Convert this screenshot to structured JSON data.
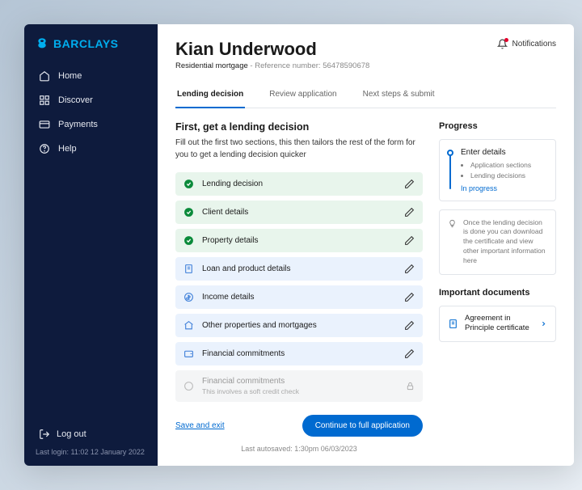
{
  "brand": "BARCLAYS",
  "nav": {
    "home": "Home",
    "discover": "Discover",
    "payments": "Payments",
    "help": "Help"
  },
  "logout": "Log out",
  "last_login": "Last login: 11:02 12 January 2022",
  "applicant_name": "Kian Underwood",
  "product": "Residential mortgage",
  "ref_prefix": " - Reference number: ",
  "ref_number": "56478590678",
  "notifications": "Notifications",
  "tabs": {
    "lending": "Lending decision",
    "review": "Review application",
    "next": "Next steps & submit"
  },
  "section": {
    "title": "First, get a lending decision",
    "desc": "Fill out the first two sections, this then tailors the rest of the form for you to get a lending decision quicker"
  },
  "items": {
    "lending": "Lending decision",
    "client": "Client details",
    "property": "Property details",
    "loan": "Loan and product details",
    "income": "Income details",
    "other": "Other properties and mortgages",
    "fin": "Financial commitments",
    "locked_title": "Financial commitments",
    "locked_sub": "This involves a soft credit check"
  },
  "save_exit": "Save and exit",
  "cta": "Continue to full application",
  "autosave": "Last autosaved:  1:30pm 06/03/2023",
  "progress": {
    "title": "Progress",
    "step": "Enter details",
    "b1": "Application sections",
    "b2": "Lending decisions",
    "status": "In progress",
    "hint": "Once the lending decision is done you can download the certificate and view other important information here"
  },
  "docs": {
    "title": "Important documents",
    "item1": "Agreement in Principle certificate"
  }
}
